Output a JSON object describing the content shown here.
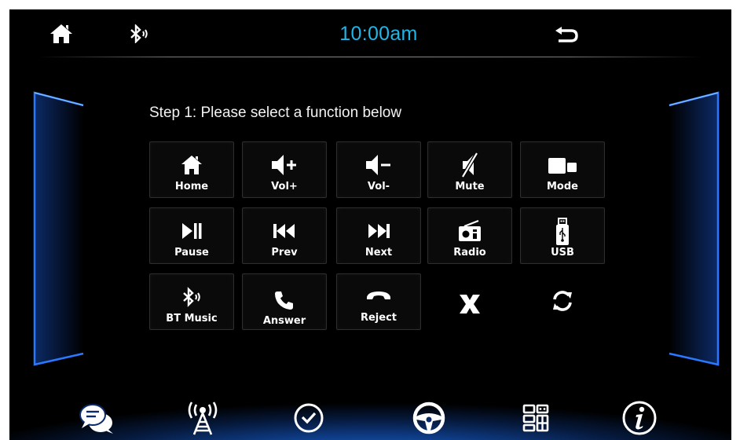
{
  "status_bar": {
    "time": "10:00am",
    "icons": [
      "home-icon",
      "bluetooth-audio-icon",
      "back-icon"
    ]
  },
  "prompt": "Step 1: Please select a function below",
  "functions": {
    "home": {
      "label": "Home",
      "icon": "home-icon"
    },
    "vol_up": {
      "label": "Vol+",
      "icon": "volume-up-icon"
    },
    "vol_down": {
      "label": "Vol-",
      "icon": "volume-down-icon"
    },
    "mute": {
      "label": "Mute",
      "icon": "mute-icon"
    },
    "mode": {
      "label": "Mode",
      "icon": "mode-icon"
    },
    "pause": {
      "label": "Pause",
      "icon": "play-pause-icon"
    },
    "prev": {
      "label": "Prev",
      "icon": "previous-track-icon"
    },
    "next": {
      "label": "Next",
      "icon": "next-track-icon"
    },
    "radio": {
      "label": "Radio",
      "icon": "radio-icon"
    },
    "usb": {
      "label": "USB",
      "icon": "usb-icon"
    },
    "bt_music": {
      "label": "BT Music",
      "icon": "bluetooth-music-icon"
    },
    "answer": {
      "label": "Answer",
      "icon": "phone-answer-icon"
    },
    "reject": {
      "label": "Reject",
      "icon": "phone-reject-icon"
    },
    "clear": {
      "label": "",
      "icon": "close-x-icon"
    },
    "reset": {
      "label": "",
      "icon": "refresh-icon"
    }
  },
  "dock": [
    "chat-icon",
    "antenna-icon",
    "clock-icon",
    "steering-wheel-icon",
    "apps-grid-icon",
    "info-icon"
  ],
  "colors": {
    "accent_time": "#1fb6e8",
    "panel_glow": "#1e64e0",
    "dock_glow": "#1e66c8",
    "background": "#000000"
  }
}
